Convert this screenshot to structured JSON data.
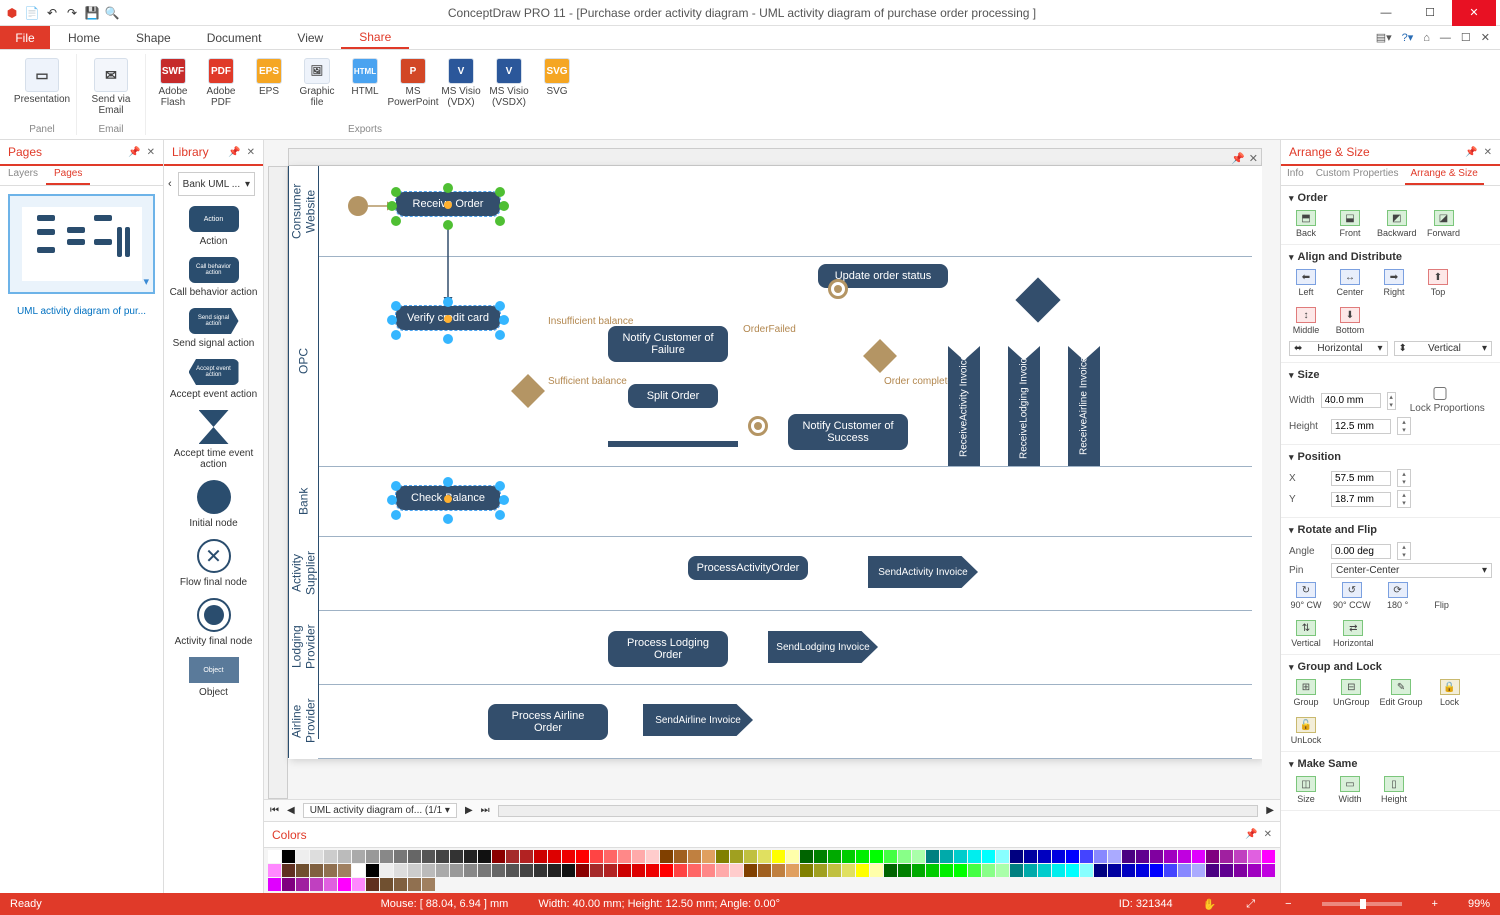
{
  "app": {
    "title": "ConceptDraw PRO 11 - [Purchase order activity diagram - UML activity diagram of purchase order processing ]"
  },
  "tabs": {
    "file": "File",
    "home": "Home",
    "shape": "Shape",
    "document": "Document",
    "view": "View",
    "share": "Share"
  },
  "ribbon": {
    "groups": [
      {
        "label": "Panel",
        "items": [
          {
            "label": "Presentation",
            "icon": "▶"
          }
        ]
      },
      {
        "label": "Email",
        "items": [
          {
            "label": "Send via Email",
            "icon": "✉"
          }
        ]
      },
      {
        "label": "Exports",
        "items": [
          {
            "label": "Adobe Flash",
            "icon": "SWF"
          },
          {
            "label": "Adobe PDF",
            "icon": "PDF"
          },
          {
            "label": "EPS",
            "icon": "EPS"
          },
          {
            "label": "Graphic file",
            "icon": "🖼"
          },
          {
            "label": "HTML",
            "icon": "HTML"
          },
          {
            "label": "MS PowerPoint",
            "icon": "P"
          },
          {
            "label": "MS Visio (VDX)",
            "icon": "V"
          },
          {
            "label": "MS Visio (VSDX)",
            "icon": "V"
          },
          {
            "label": "SVG",
            "icon": "SVG"
          }
        ]
      }
    ]
  },
  "pages": {
    "title": "Pages",
    "tabs": {
      "layers": "Layers",
      "pages": "Pages"
    },
    "thumb_label": "UML activity diagram of pur..."
  },
  "library": {
    "title": "Library",
    "selector": "Bank UML ...",
    "items": [
      {
        "label": "Action",
        "txt": "Action"
      },
      {
        "label": "Call behavior action",
        "txt": "Call behavior action"
      },
      {
        "label": "Send signal action",
        "txt": "Send signal action"
      },
      {
        "label": "Accept event action",
        "txt": "Accept event action"
      },
      {
        "label": "Accept time event action",
        "shape": "hourglass"
      },
      {
        "label": "Initial node",
        "shape": "circle"
      },
      {
        "label": "Flow final node",
        "shape": "circlex"
      },
      {
        "label": "Activity final node",
        "shape": "ring"
      },
      {
        "label": "Object",
        "txt": "Object"
      }
    ]
  },
  "diagram": {
    "lanes": [
      "Consumer Website",
      "OPC",
      "Bank",
      "Activity Supplier",
      "Lodging Provider",
      "Airline Provider"
    ],
    "nodes": {
      "receive": "Receive Order",
      "verify": "Verify credit card",
      "check": "Check Balance",
      "notify_fail": "Notify Customer of Failure",
      "split": "Split Order",
      "update": "Update order status",
      "notify_ok": "Notify Customer of Success",
      "proc_act": "ProcessActivityOrder",
      "send_act": "SendActivity Invoice",
      "proc_lodg": "Process Lodging Order",
      "send_lodg": "SendLodging Invoice",
      "proc_air": "Process Airline Order",
      "send_air": "SendAirline Invoice",
      "recv_act": "ReceiveActivity Invoice",
      "recv_lodg": "ReceiveLodging Invoice",
      "recv_air": "ReceiveAirline Invoice"
    },
    "labels": {
      "insuf": "Insufficient balance",
      "suf": "Sufficient balance",
      "ofail": "OrderFailed",
      "ocomp": "Order complete"
    }
  },
  "right": {
    "title": "Arrange & Size",
    "tabs": {
      "info": "Info",
      "custom": "Custom Properties",
      "arrange": "Arrange & Size"
    },
    "order": {
      "h": "Order",
      "items": [
        "Back",
        "Front",
        "Backward",
        "Forward"
      ]
    },
    "align": {
      "h": "Align and Distribute",
      "items": [
        "Left",
        "Center",
        "Right",
        "Top",
        "Middle",
        "Bottom"
      ],
      "hsel": "Horizontal",
      "vsel": "Vertical"
    },
    "size": {
      "h": "Size",
      "width_lbl": "Width",
      "width": "40.0 mm",
      "height_lbl": "Height",
      "height": "12.5 mm",
      "lock": "Lock Proportions"
    },
    "pos": {
      "h": "Position",
      "x_lbl": "X",
      "x": "57.5 mm",
      "y_lbl": "Y",
      "y": "18.7 mm"
    },
    "rotate": {
      "h": "Rotate and Flip",
      "angle_lbl": "Angle",
      "angle": "0.00 deg",
      "pin_lbl": "Pin",
      "pin": "Center-Center",
      "items": [
        "90° CW",
        "90° CCW",
        "180 °",
        "Flip",
        "Vertical",
        "Horizontal"
      ]
    },
    "group": {
      "h": "Group and Lock",
      "items": [
        "Group",
        "UnGroup",
        "Edit Group",
        "Lock",
        "UnLock"
      ]
    },
    "make": {
      "h": "Make Same",
      "items": [
        "Size",
        "Width",
        "Height"
      ]
    }
  },
  "canvas_tab": "UML activity diagram of... (1/1",
  "colors_title": "Colors",
  "status": {
    "ready": "Ready",
    "mouse": "Mouse: [ 88.04, 6.94 ] mm",
    "dims": "Width: 40.00 mm;  Height: 12.50 mm;  Angle: 0.00°",
    "id": "ID: 321344",
    "zoom": "99%"
  }
}
